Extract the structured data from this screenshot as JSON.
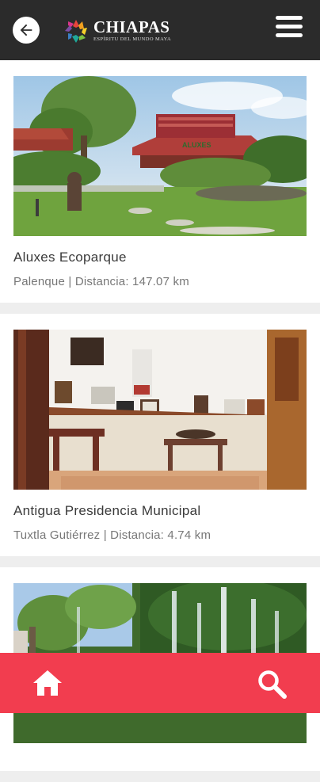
{
  "header": {
    "back_icon": "arrow-left-icon",
    "logo_title": "CHIAPAS",
    "logo_subtitle": "ESPÍRITU DEL MUNDO MAYA",
    "menu_icon": "hamburger-menu-icon"
  },
  "places": [
    {
      "name": "Aluxes Ecoparque",
      "location": "Palenque | Distancia: 147.07 km",
      "sign_text": "ALUXES"
    },
    {
      "name": "Antigua Presidencia Municipal",
      "location": "Tuxtla Gutiérrez | Distancia: 4.74 km"
    },
    {
      "name": "",
      "location": ""
    }
  ],
  "bottom_nav": {
    "home_icon": "home-icon",
    "search_icon": "search-icon"
  },
  "colors": {
    "topbar": "#2b2b2b",
    "bottombar": "#f23d4f",
    "background": "#eeeeee"
  }
}
